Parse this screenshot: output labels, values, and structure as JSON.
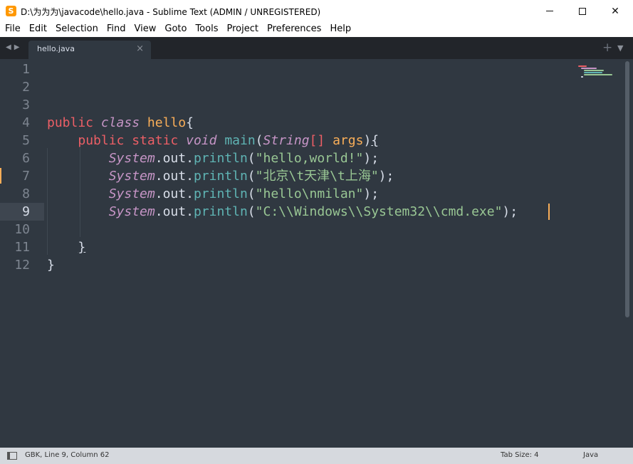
{
  "window": {
    "title": "D:\\为为为\\javacode\\hello.java - Sublime Text (ADMIN / UNREGISTERED)",
    "app_icon_letter": "S",
    "minimize_icon": "minimize-icon",
    "maximize_icon": "maximize-icon",
    "close_glyph": "✕"
  },
  "menu": [
    "File",
    "Edit",
    "Selection",
    "Find",
    "View",
    "Goto",
    "Tools",
    "Project",
    "Preferences",
    "Help"
  ],
  "tabs": {
    "nav_arrows": "◀▶",
    "active": {
      "label": "hello.java",
      "close": "×"
    },
    "add": "+",
    "menu": "▼"
  },
  "editor": {
    "current_line": 9,
    "modified_line": 7,
    "line_numbers": [
      "1",
      "2",
      "3",
      "4",
      "5",
      "6",
      "7",
      "8",
      "9",
      "10",
      "11",
      "12"
    ],
    "lines": [
      {
        "n": 1,
        "tokens": []
      },
      {
        "n": 2,
        "tokens": []
      },
      {
        "n": 3,
        "tokens": []
      },
      {
        "n": 4,
        "tokens": [
          {
            "t": "public",
            "c": "kw"
          },
          {
            "t": " "
          },
          {
            "t": "class",
            "c": "st"
          },
          {
            "t": " "
          },
          {
            "t": "hello",
            "c": "cls"
          },
          {
            "t": "{",
            "c": "pun"
          }
        ]
      },
      {
        "n": 5,
        "tokens": [
          {
            "t": "    "
          },
          {
            "t": "public",
            "c": "kw"
          },
          {
            "t": " "
          },
          {
            "t": "static",
            "c": "kw"
          },
          {
            "t": " "
          },
          {
            "t": "void",
            "c": "st"
          },
          {
            "t": " "
          },
          {
            "t": "main",
            "c": "fn"
          },
          {
            "t": "(",
            "c": "pun"
          },
          {
            "t": "String",
            "c": "st"
          },
          {
            "t": "[]",
            "c": "kw"
          },
          {
            "t": " "
          },
          {
            "t": "args",
            "c": "arg"
          },
          {
            "t": ")",
            "c": "pun"
          },
          {
            "t": "{",
            "c": "br"
          }
        ]
      },
      {
        "n": 6,
        "tokens": [
          {
            "t": "        "
          },
          {
            "t": "System",
            "c": "st"
          },
          {
            "t": ".",
            "c": "pun"
          },
          {
            "t": "out",
            "c": "pun"
          },
          {
            "t": ".",
            "c": "pun"
          },
          {
            "t": "println",
            "c": "fn"
          },
          {
            "t": "(",
            "c": "pun"
          },
          {
            "t": "\"hello,world!\"",
            "c": "str"
          },
          {
            "t": ");",
            "c": "pun"
          }
        ]
      },
      {
        "n": 7,
        "tokens": [
          {
            "t": "        "
          },
          {
            "t": "System",
            "c": "st"
          },
          {
            "t": ".",
            "c": "pun"
          },
          {
            "t": "out",
            "c": "pun"
          },
          {
            "t": ".",
            "c": "pun"
          },
          {
            "t": "println",
            "c": "fn"
          },
          {
            "t": "(",
            "c": "pun"
          },
          {
            "t": "\"北京\\t天津\\t上海\"",
            "c": "str"
          },
          {
            "t": ");",
            "c": "pun"
          }
        ]
      },
      {
        "n": 8,
        "tokens": [
          {
            "t": "        "
          },
          {
            "t": "System",
            "c": "st"
          },
          {
            "t": ".",
            "c": "pun"
          },
          {
            "t": "out",
            "c": "pun"
          },
          {
            "t": ".",
            "c": "pun"
          },
          {
            "t": "println",
            "c": "fn"
          },
          {
            "t": "(",
            "c": "pun"
          },
          {
            "t": "\"hello\\nmilan\"",
            "c": "str"
          },
          {
            "t": ");",
            "c": "pun"
          }
        ]
      },
      {
        "n": 9,
        "tokens": [
          {
            "t": "        "
          },
          {
            "t": "System",
            "c": "st"
          },
          {
            "t": ".",
            "c": "pun"
          },
          {
            "t": "out",
            "c": "pun"
          },
          {
            "t": ".",
            "c": "pun"
          },
          {
            "t": "println",
            "c": "fn"
          },
          {
            "t": "(",
            "c": "pun"
          },
          {
            "t": "\"C:\\\\Windows\\\\System32\\\\cmd.exe\"",
            "c": "str"
          },
          {
            "t": ");",
            "c": "pun"
          }
        ]
      },
      {
        "n": 10,
        "tokens": []
      },
      {
        "n": 11,
        "tokens": [
          {
            "t": "    "
          },
          {
            "t": "}",
            "c": "br"
          }
        ]
      },
      {
        "n": 12,
        "tokens": [
          {
            "t": "}",
            "c": "pun"
          }
        ]
      }
    ]
  },
  "status": {
    "position": "GBK, Line 9, Column 62",
    "tab_size": "Tab Size: 4",
    "syntax": "Java"
  },
  "colors": {
    "editor_bg": "#303841",
    "keyword": "#ec5f66",
    "storage": "#c695c6",
    "class": "#f9ae58",
    "function": "#5fb4b4",
    "string": "#99c794",
    "text": "#d8dee9",
    "caret": "#f9ae58"
  }
}
